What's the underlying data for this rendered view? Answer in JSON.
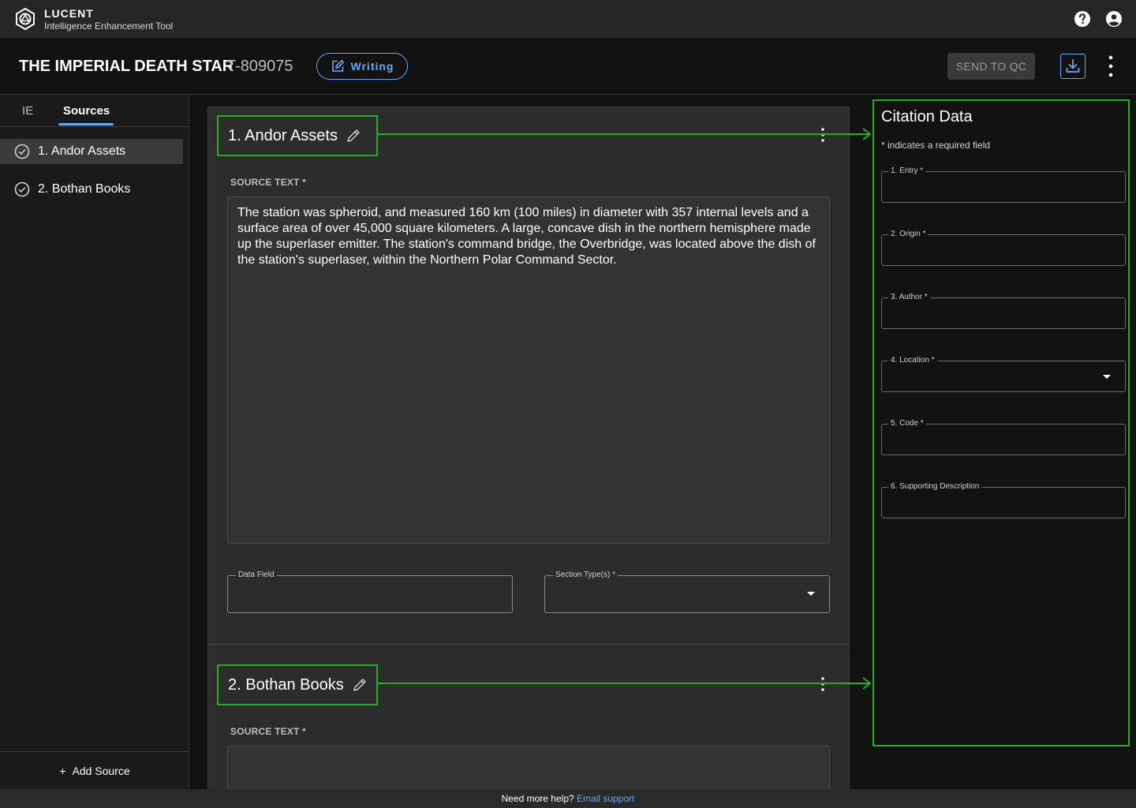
{
  "app": {
    "brand_name": "LUCENT",
    "brand_subtitle": "Intelligence Enhancement Tool"
  },
  "header": {
    "title": "THE IMPERIAL DEATH STAR",
    "doc_id": "T-809075",
    "writing_label": "Writing",
    "send_label": "SEND TO QC"
  },
  "sidebar": {
    "tabs": [
      {
        "label": "IE"
      },
      {
        "label": "Sources",
        "active": true
      }
    ],
    "items": [
      {
        "label": "1. Andor Assets",
        "active": true
      },
      {
        "label": "2. Bothan Books"
      }
    ],
    "add_label": "Add Source",
    "add_glyph": "+"
  },
  "sections": [
    {
      "title": "1. Andor Assets",
      "source_label": "SOURCE TEXT *",
      "source_text": "The station was spheroid, and measured 160 km (100 miles) in diameter with 357 internal levels and a surface area of over 45,000 square kilometers. A large, concave dish in the northern hemisphere made up the superlaser emitter. The station's command bridge, the Overbridge, was located above the dish of the station's superlaser, within the Northern Polar Command Sector.",
      "data_field_label": "Data Field",
      "section_type_label": "Section Type(s) *"
    },
    {
      "title": "2. Bothan Books",
      "source_label": "SOURCE TEXT *",
      "source_text": ""
    }
  ],
  "citation": {
    "title": "Citation Data",
    "required_note": "* indicates a required field",
    "fields": [
      {
        "label": "1. Entry *"
      },
      {
        "label": "2. Origin *"
      },
      {
        "label": "3. Author *"
      },
      {
        "label": "4. Location *",
        "dropdown": true
      },
      {
        "label": "5. Code *"
      },
      {
        "label": "6. Supporting Description"
      }
    ]
  },
  "footer": {
    "text": "Need more help?",
    "link": "Email support"
  },
  "colors": {
    "accent": "#64a9f5",
    "highlight": "#22b022",
    "background": "#121212",
    "card": "#2c2c2c"
  }
}
